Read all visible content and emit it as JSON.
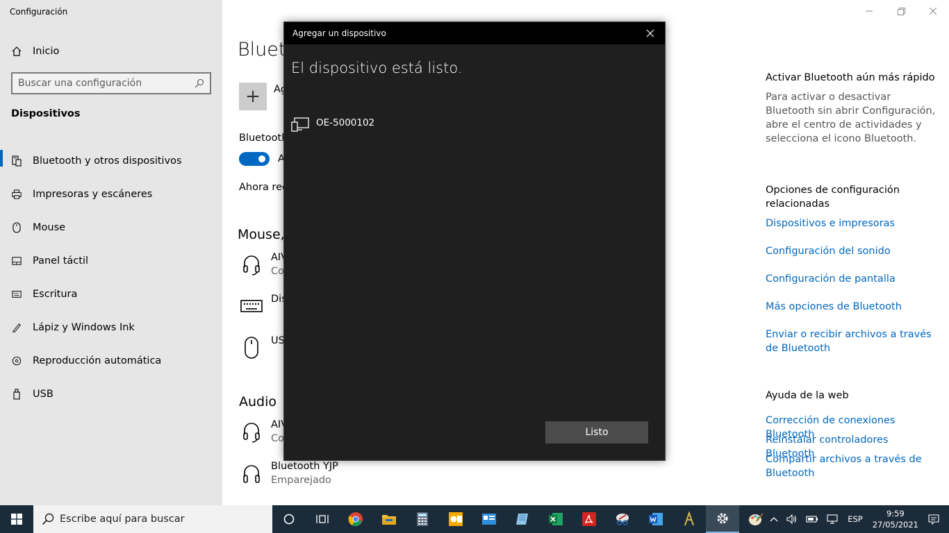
{
  "app": {
    "title": "Configuración",
    "home_label": "Inicio",
    "search_placeholder": "Buscar una configuración",
    "section_title": "Dispositivos"
  },
  "sidebar": {
    "items": [
      {
        "label": "Bluetooth y otros dispositivos",
        "icon": "bluetooth-devices-icon"
      },
      {
        "label": "Impresoras y escáneres",
        "icon": "printer-icon"
      },
      {
        "label": "Mouse",
        "icon": "mouse-icon"
      },
      {
        "label": "Panel táctil",
        "icon": "touchpad-icon"
      },
      {
        "label": "Escritura",
        "icon": "keyboard-icon"
      },
      {
        "label": "Lápiz y Windows Ink",
        "icon": "pen-icon"
      },
      {
        "label": "Reproducción automática",
        "icon": "autoplay-icon"
      },
      {
        "label": "USB",
        "icon": "usb-icon"
      }
    ]
  },
  "main": {
    "title": "Blueto",
    "add_label": "Ag",
    "bt_label": "Bluetooth",
    "toggle_label": "A",
    "discover_text": "Ahora rec",
    "mouse_heading": "Mouse,",
    "audio_heading": "Audio",
    "mouse_devices": [
      {
        "name": "AIV",
        "status": "Co"
      },
      {
        "name": "Dis",
        "status": ""
      },
      {
        "name": "US",
        "status": ""
      }
    ],
    "audio_devices": [
      {
        "name": "AIV",
        "status": "Co"
      },
      {
        "name": "Bluetooth  YJP",
        "status": "Emparejado"
      }
    ]
  },
  "right_panel": {
    "quick_heading": "Activar Bluetooth aún más rápido",
    "quick_text": "Para activar o desactivar Bluetooth sin abrir Configuración, abre el centro de actividades y selecciona el icono Bluetooth.",
    "related_heading": "Opciones de configuración relacionadas",
    "related_links": [
      "Dispositivos e impresoras",
      "Configuración del sonido",
      "Configuración de pantalla",
      "Más opciones de Bluetooth",
      "Enviar o recibir archivos a través de Bluetooth"
    ],
    "help_heading": "Ayuda de la web",
    "help_links": [
      "Corrección de conexiones Bluetooth",
      "Reinstalar controladores Bluetooth",
      "Compartir archivos a través de Bluetooth"
    ]
  },
  "dialog": {
    "title": "Agregar un dispositivo",
    "heading": "El dispositivo está listo.",
    "device_name": "OE-5000102",
    "done_label": "Listo"
  },
  "taskbar": {
    "search_placeholder": "Escribe aquí para buscar",
    "language": "ESP",
    "time": "9:59",
    "date": "27/05/2021"
  },
  "colors": {
    "accent": "#0067c0",
    "dialog_bg": "#1f1f1f",
    "taskbar_bg": "#1c2b3a"
  }
}
